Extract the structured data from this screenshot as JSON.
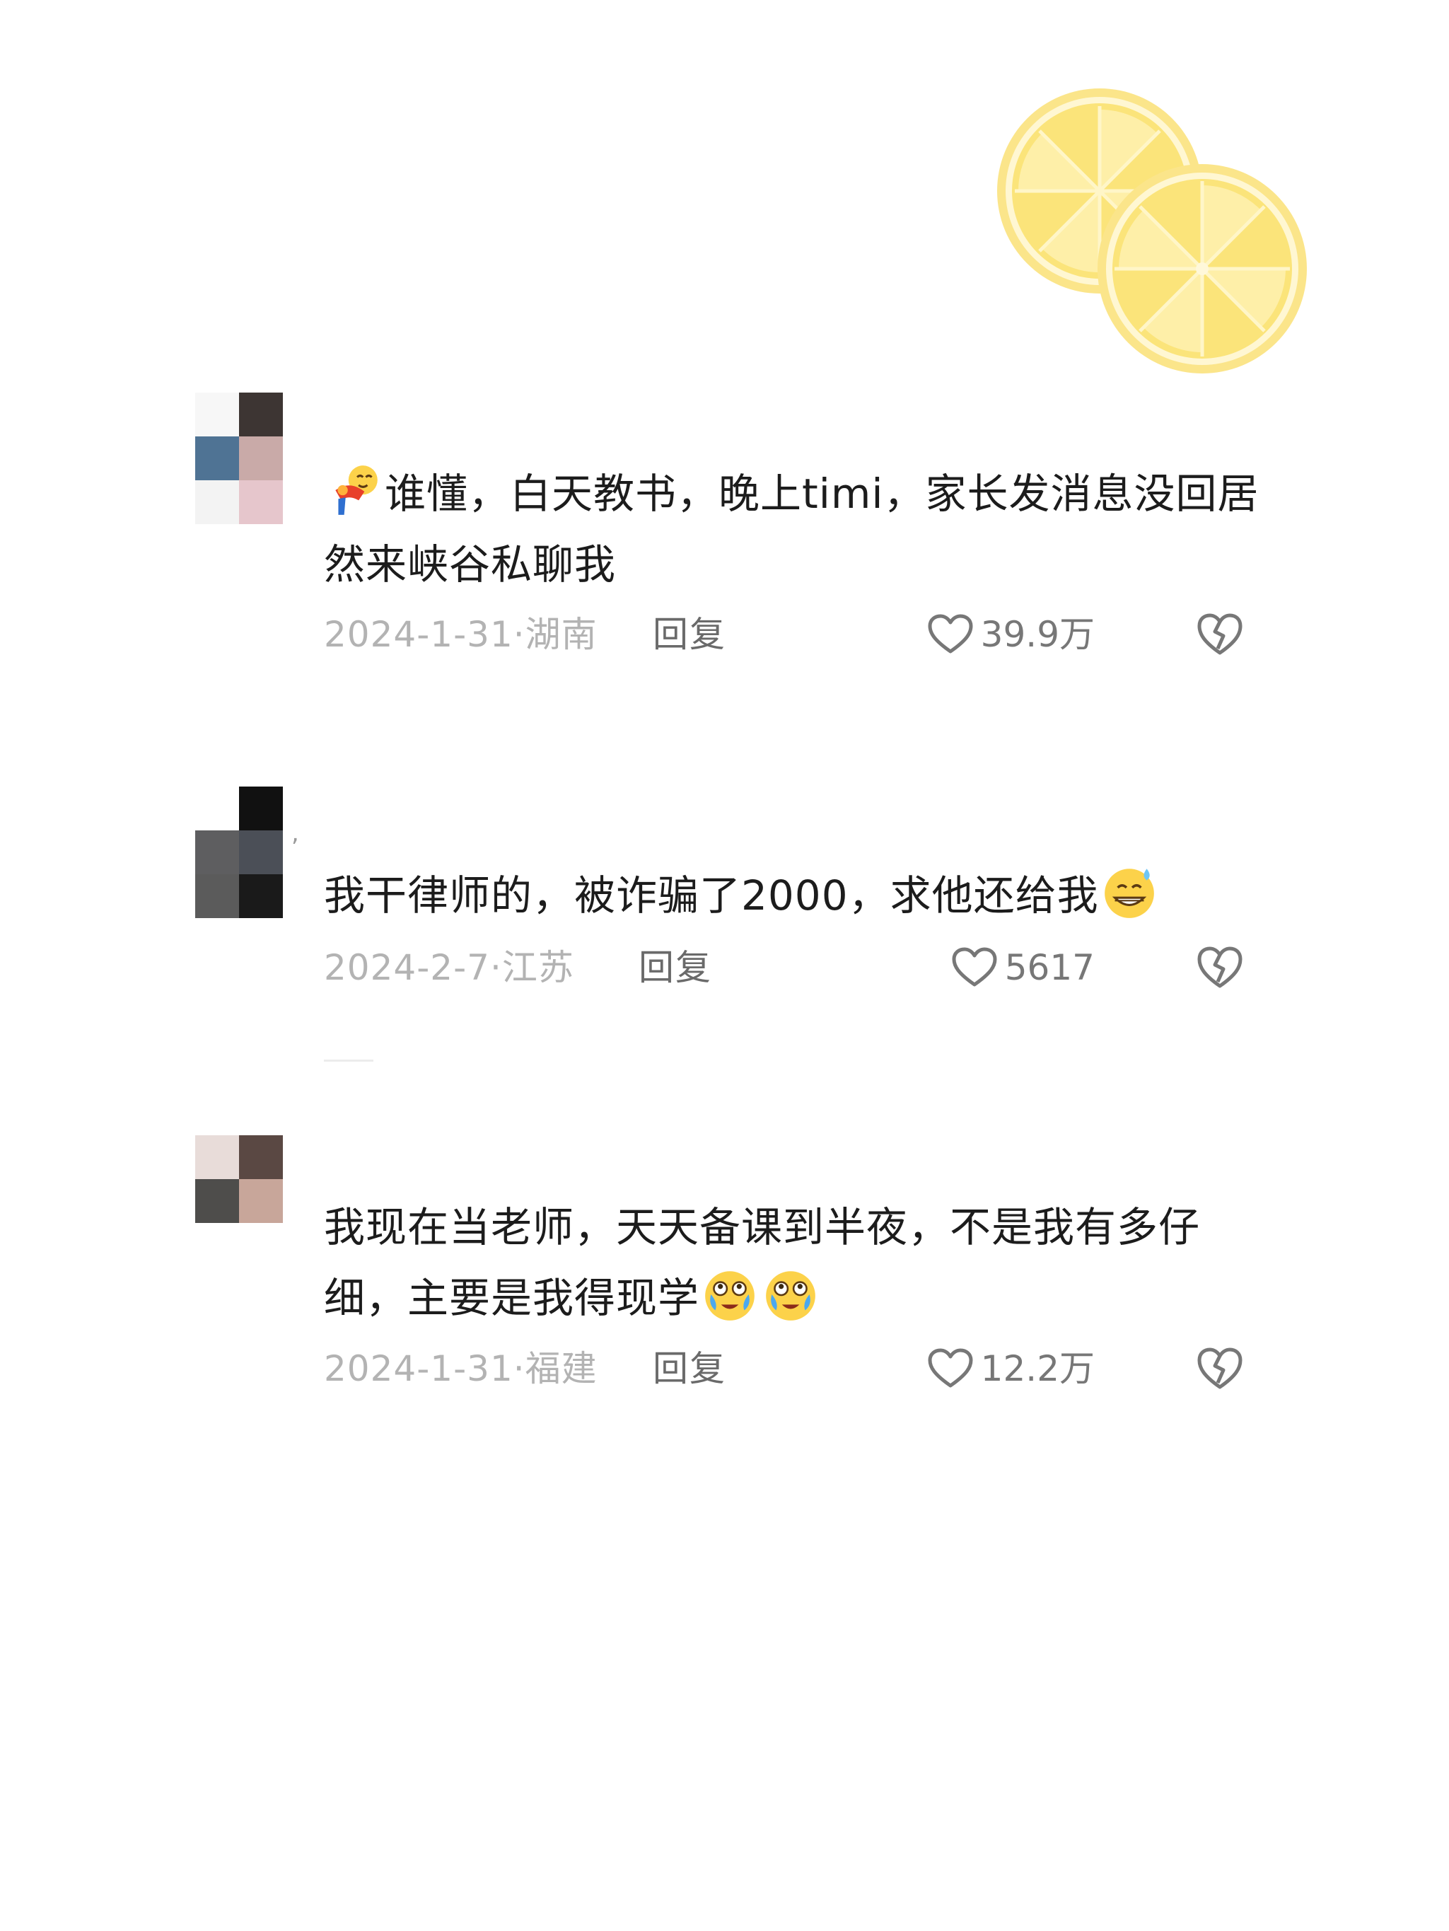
{
  "colors": {
    "text": "#1c1c1c",
    "meta": "#b3b3b3",
    "reply": "#6a6a6a",
    "likes": "#777777",
    "lemon": "#f7de5c"
  },
  "comments": [
    {
      "avatar": "avatar-mosaic",
      "emoji_lead": "emoji-person-bowing",
      "text": "谁懂，白天教书，晚上timi，家长发消息没回居然来峡谷私聊我",
      "date": "2024-1-31·",
      "region": "湖南",
      "reply_label": "回复",
      "likes": "39.9万"
    },
    {
      "avatar": "avatar-mosaic",
      "text": "我干律师的，被诈骗了2000，求他还给我",
      "emoji_trail": [
        "emoji-grinning-sweat"
      ],
      "date": "2024-2-7·",
      "region": "江苏",
      "reply_label": "回复",
      "likes": "5617"
    },
    {
      "avatar": "avatar-mosaic",
      "text": "我现在当老师，天天备课到半夜，不是我有多仔细，主要是我得现学",
      "emoji_trail": [
        "emoji-crying-laughing",
        "emoji-crying-laughing"
      ],
      "date": "2024-1-31·",
      "region": "福建",
      "reply_label": "回复",
      "likes": "12.2万"
    }
  ]
}
